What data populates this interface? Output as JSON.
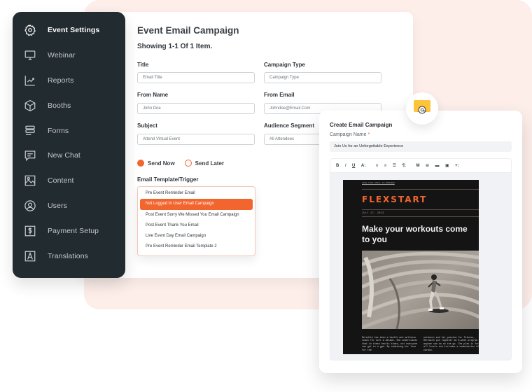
{
  "sidebar": {
    "items": [
      {
        "label": "Event Settings",
        "icon": "gear-icon",
        "active": true
      },
      {
        "label": "Webinar",
        "icon": "monitor-icon"
      },
      {
        "label": "Reports",
        "icon": "chart-icon"
      },
      {
        "label": "Booths",
        "icon": "box-icon"
      },
      {
        "label": "Forms",
        "icon": "forms-icon"
      },
      {
        "label": "New Chat",
        "icon": "chat-icon"
      },
      {
        "label": "Content",
        "icon": "image-icon"
      },
      {
        "label": "Users",
        "icon": "user-icon"
      },
      {
        "label": "Payment Setup",
        "icon": "dollar-icon"
      },
      {
        "label": "Translations",
        "icon": "translate-icon"
      }
    ]
  },
  "main": {
    "title": "Event Email Campaign",
    "subtitle": "Showing 1-1 Of 1 Item.",
    "fields": {
      "title": {
        "label": "Title",
        "placeholder": "Email Title"
      },
      "campaign_type": {
        "label": "Campaign Type",
        "placeholder": "Campaign Type"
      },
      "from_name": {
        "label": "From Name",
        "value": "John Doe"
      },
      "from_email": {
        "label": "From Email",
        "value": "Johndoe@Email.Com"
      },
      "subject": {
        "label": "Subject",
        "value": "Attend Virtual Event"
      },
      "audience_segment": {
        "label": "Audience Segment",
        "value": "All Attendees"
      }
    },
    "send_options": {
      "send_now": "Send Now",
      "send_later": "Send Later",
      "selected": "send_now"
    },
    "template": {
      "label": "Email Template/Trigger",
      "options": [
        "Pre Event Reminder Email",
        "Not Logged In User Email Campaign",
        "Post Event Sorry We Missed You Email Campaign",
        "Post Event Thank You Email",
        "Live Event Day Email Campaign",
        "Pre Event Reminder Email Template 2"
      ],
      "selected_index": 1
    }
  },
  "email_campaign": {
    "title": "Create Email Campaign",
    "name_label": "Campaign Name",
    "required_mark": "*",
    "name_value": "Join Us for an Unforgettable Experience",
    "toolbar": [
      "B",
      "I",
      "U",
      "A:",
      "≡",
      "≡",
      "☰",
      "¶:",
      "M",
      "⊖",
      "▬",
      "▣",
      "+:"
    ],
    "preview": {
      "top_link": "VIEW THIS EMAIL IN BROWSER",
      "brand": "FLEXSTART",
      "date": "JULY 17, 2023",
      "headline": "Make your workouts come to you",
      "body_left": "Meredith has been a health and wellness coach for over a decade. She understands that in these hectic times, not everyone can get to a gym. By combining her love for the",
      "body_right": "outdoors and her passion for fitness, Meredith put together an 8-week program anyone can do on the go. The plan is for all levels and includes a combination of cardio."
    }
  },
  "colors": {
    "accent": "#f2652f",
    "sidebar_bg": "#222b30",
    "background_pink": "#fdeeea",
    "badge_yellow": "#fdc43a"
  }
}
